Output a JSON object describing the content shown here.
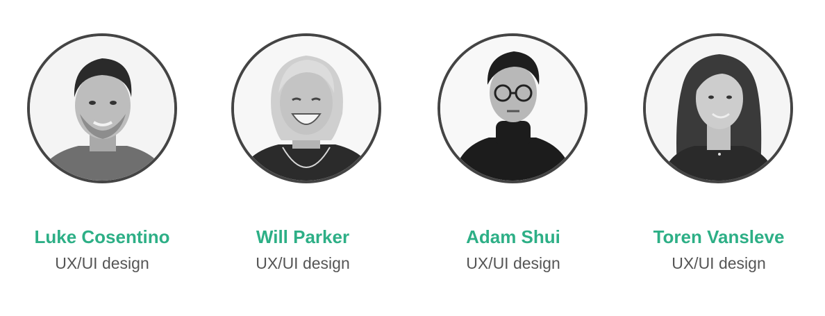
{
  "members": [
    {
      "name": "Luke Cosentino",
      "role": "UX/UI design",
      "photo": "portrait-photo"
    },
    {
      "name": "Will Parker",
      "role": "UX/UI design",
      "photo": "portrait-photo"
    },
    {
      "name": "Adam Shui",
      "role": "UX/UI design",
      "photo": "portrait-photo"
    },
    {
      "name": "Toren Vansleve",
      "role": "UX/UI design",
      "photo": "portrait-photo"
    }
  ],
  "colors": {
    "name": "#2daf86",
    "role": "#555555",
    "avatar_border": "#444444"
  }
}
